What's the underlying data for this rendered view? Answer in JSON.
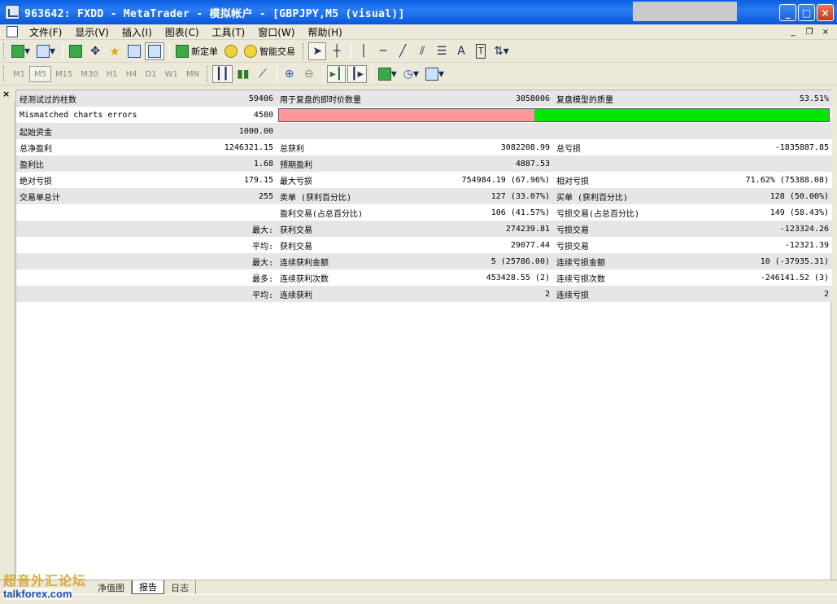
{
  "window": {
    "title": "963642: FXDD - MetaTrader - 模拟帐户 - [GBPJPY,M5 (visual)]",
    "min_glyph": "_",
    "max_glyph": "□",
    "close_glyph": "×"
  },
  "menu": {
    "items": [
      "文件(F)",
      "显示(V)",
      "插入(I)",
      "图表(C)",
      "工具(T)",
      "窗口(W)",
      "帮助(H)"
    ],
    "mdi_min": "_",
    "mdi_restore": "❐",
    "mdi_close": "×"
  },
  "toolbar1": {
    "new_order_label": "新定单",
    "expert_label": "智能交易",
    "text_tool": "A",
    "label_tool": "T"
  },
  "toolbar2": {
    "timeframes": [
      "M1",
      "M5",
      "M15",
      "M30",
      "H1",
      "H4",
      "D1",
      "W1",
      "MN"
    ],
    "active_timeframe": "M5"
  },
  "panel": {
    "close_glyph": "×"
  },
  "report": {
    "bars_label": "经测试过的柱数",
    "bars_value": "59406",
    "ticks_label": "用于复盘的即时价数量",
    "ticks_value": "3058006",
    "quality_label": "复盘模型的质量",
    "quality_value": "53.51%",
    "mismatch_label": "Mismatched charts errors",
    "mismatch_value": "4580",
    "initial_label": "起始资金",
    "initial_value": "1000.00",
    "netprofit_label": "总净盈利",
    "netprofit_value": "1246321.15",
    "grossprofit_label": "总获利",
    "grossprofit_value": "3082208.99",
    "grossloss_label": "总亏损",
    "grossloss_value": "-1835887.85",
    "pf_label": "盈利比",
    "pf_value": "1.68",
    "payoff_label": "预期盈利",
    "payoff_value": "4887.53",
    "absdd_label": "绝对亏损",
    "absdd_value": "179.15",
    "maxdd_label": "最大亏损",
    "maxdd_value": "754984.19 (67.96%)",
    "reldd_label": "相对亏损",
    "reldd_value": "71.62% (75388.08)",
    "trades_label": "交易单总计",
    "trades_value": "255",
    "short_label": "卖单 (获利百分比)",
    "short_value": "127 (33.07%)",
    "long_label": "买单 (获利百分比)",
    "long_value": "128 (50.00%)",
    "profittrades_label": "盈利交易(占总百分比)",
    "profittrades_value": "106 (41.57%)",
    "losstrades_label": "亏损交易(占总百分比)",
    "losstrades_value": "149 (58.43%)",
    "max1_label": "最大:",
    "largest_profit_label": "获利交易",
    "largest_profit_value": "274239.81",
    "largest_loss_label": "亏损交易",
    "largest_loss_value": "-123324.26",
    "avg1_label": "平均:",
    "avg_profit_label": "获利交易",
    "avg_profit_value": "29077.44",
    "avg_loss_label": "亏损交易",
    "avg_loss_value": "-12321.39",
    "max2_label": "最大:",
    "max_conswins_label": "连续获利金额",
    "max_conswins_value": "5 (25786.00)",
    "max_consloss_label": "连续亏损金额",
    "max_consloss_value": "10 (-37935.31)",
    "most_label": "最多:",
    "max_consprofit_label": "连续获利次数",
    "max_consprofit_value": "453428.55 (2)",
    "max_consloss2_label": "连续亏损次数",
    "max_consloss2_value": "-246141.52 (3)",
    "avg2_label": "平均:",
    "avg_conswins_label": "连续获利",
    "avg_conswins_value": "2",
    "avg_consloss_label": "连续亏损",
    "avg_consloss_value": "2",
    "quality_fraction": 0.5351
  },
  "tabs": {
    "items": [
      "净值图",
      "报告",
      "日志"
    ],
    "active": "报告"
  },
  "watermark": {
    "line1": "超音外汇论坛",
    "line2": "talkforex.com"
  }
}
